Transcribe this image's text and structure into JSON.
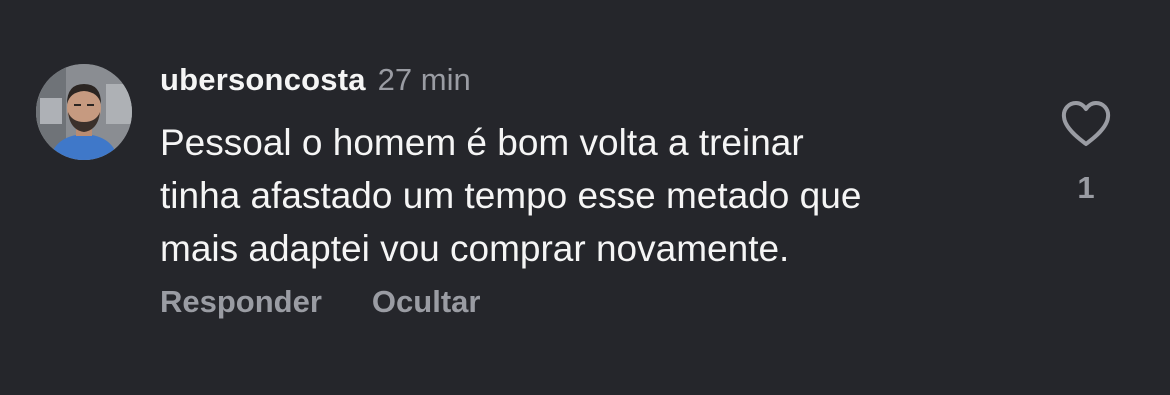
{
  "comment": {
    "username": "ubersoncosta",
    "timestamp": "27 min",
    "text": "Pessoal o homem é bom volta a treinar\ntinha afastado um tempo esse metado que\nmais adaptei vou comprar novamente.",
    "like_icon": "heart-outline-icon",
    "like_count": "1",
    "actions": {
      "reply_label": "Responder",
      "hide_label": "Ocultar"
    }
  },
  "colors": {
    "background": "#25262b",
    "primary_text": "#f5f5f5",
    "secondary_text": "#9a9ca3"
  }
}
